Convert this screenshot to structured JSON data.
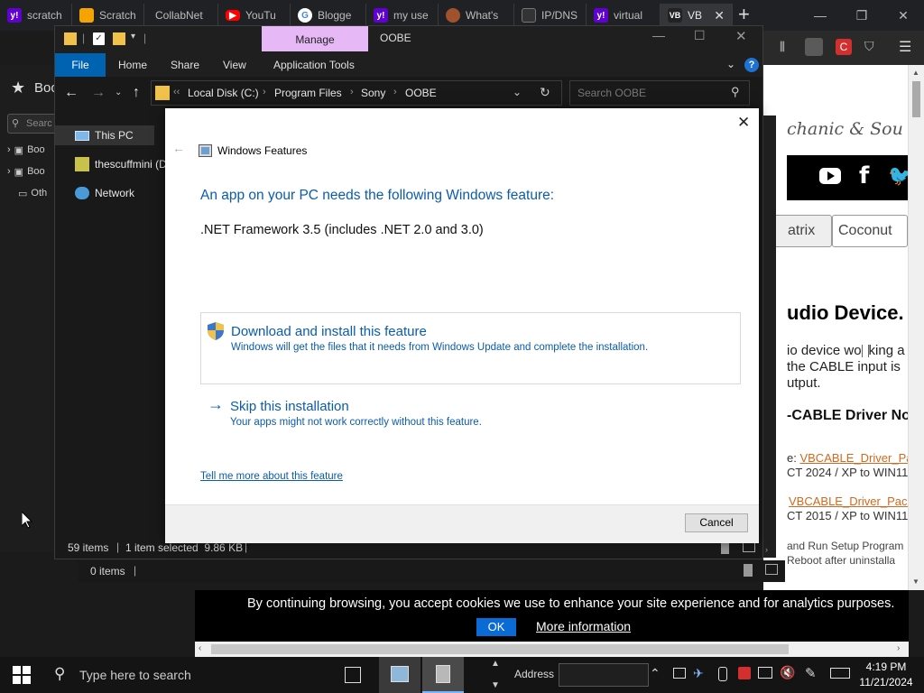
{
  "browser": {
    "tabs": [
      {
        "label": "scratch",
        "icon": "yahoo-icon",
        "color": "#6001d2"
      },
      {
        "label": "Scratch",
        "icon": "scratch-icon",
        "color": "#f5a300"
      },
      {
        "label": "CollabNet",
        "icon": "",
        "color": ""
      },
      {
        "label": "YouTu",
        "icon": "youtube-icon",
        "color": "#ff0000"
      },
      {
        "label": "Blogge",
        "icon": "google-icon",
        "color": "#ffffff"
      },
      {
        "label": "my use",
        "icon": "yahoo-icon",
        "color": "#6001d2"
      },
      {
        "label": "What's",
        "icon": "person-icon",
        "color": "#a0522d"
      },
      {
        "label": "IP/DNS",
        "icon": "ip-icon",
        "color": "#333333"
      },
      {
        "label": "virtual",
        "icon": "yahoo-icon",
        "color": "#6001d2"
      },
      {
        "label": "VB",
        "icon": "vb-icon",
        "color": "#222222"
      }
    ],
    "left_panel": {
      "bookmarks_label": "Boo",
      "search_placeholder": "Searc",
      "items": [
        "Boo",
        "Boo",
        "Oth"
      ]
    }
  },
  "explorer": {
    "context_tab": "Manage",
    "window_title": "OOBE",
    "ribbon_tabs": [
      "File",
      "Home",
      "Share",
      "View",
      "Application Tools"
    ],
    "breadcrumb": [
      "Local Disk (C:)",
      "Program Files",
      "Sony",
      "OOBE"
    ],
    "search_placeholder": "Search OOBE",
    "nav_items": [
      "This PC",
      "thescuffmini (D",
      "Network"
    ],
    "status": {
      "items": "59 items",
      "selected": "1 item selected  9.86 KB"
    },
    "status2": {
      "items": "0 items"
    }
  },
  "dialog": {
    "title": "Windows Features",
    "heading": "An app on your PC needs the following Windows feature:",
    "feature": ".NET Framework 3.5 (includes .NET 2.0 and 3.0)",
    "option1_title": "Download and install this feature",
    "option1_desc": "Windows will get the files that it needs from Windows Update and complete the installation.",
    "option2_title": "Skip this installation",
    "option2_desc": "Your apps might not work correctly without this feature.",
    "more_link": "Tell me more about this feature",
    "cancel": "Cancel"
  },
  "web": {
    "brand": "chanic & Sou",
    "tab1": "atrix",
    "tab2": "Coconut",
    "heading": "udio Device.",
    "p1": "io device wo",
    "p1b": "king a",
    "p2": "the CABLE input is",
    "p3": "utput.",
    "h2": "-CABLE Driver No",
    "dl1_prefix": "e:",
    "dl1_link": "VBCABLE_Driver_Pac",
    "dl1_sub": "CT 2024 / XP to WIN11",
    "dl2_link": "VBCABLE_Driver_Pack",
    "dl2_sub": "CT 2015 / XP to WIN11",
    "p4": "and Run Setup Program",
    "p5": "Reboot after uninstalla"
  },
  "cookie": {
    "text": "By continuing browsing, you accept cookies we use to enhance your site experience and for analytics purposes.",
    "ok": "OK",
    "more": "More information"
  },
  "taskbar": {
    "search_placeholder": "Type here to search",
    "address_label": "Address",
    "time": "4:19 PM",
    "date": "11/21/2024"
  },
  "colors": {
    "accent": "#0063b1",
    "manage_tab": "#e6b8f5",
    "link_orange": "#d2691e",
    "dialog_link": "#0a5cad"
  }
}
